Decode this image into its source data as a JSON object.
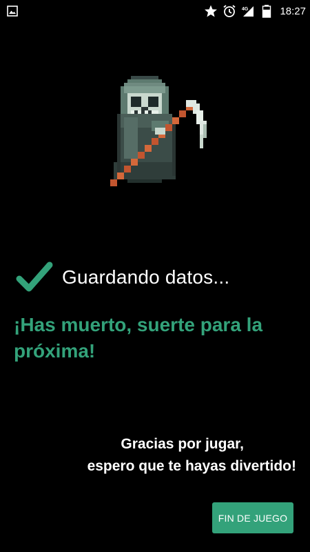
{
  "status_bar": {
    "time": "18:27",
    "network_label": "4G",
    "icons": [
      "image-notification-icon",
      "star-icon",
      "alarm-icon",
      "signal-icon",
      "battery-icon"
    ]
  },
  "main": {
    "saving_text": "Guardando datos...",
    "death_message": "¡Has muerto, suerte para la próxima!",
    "thanks_line1": "Gracias por jugar,",
    "thanks_line2": "espero que te hayas divertido!",
    "end_button_label": "FIN DE JUEGO"
  },
  "colors": {
    "background": "#000000",
    "accent": "#33a27a",
    "text": "#ffffff"
  }
}
